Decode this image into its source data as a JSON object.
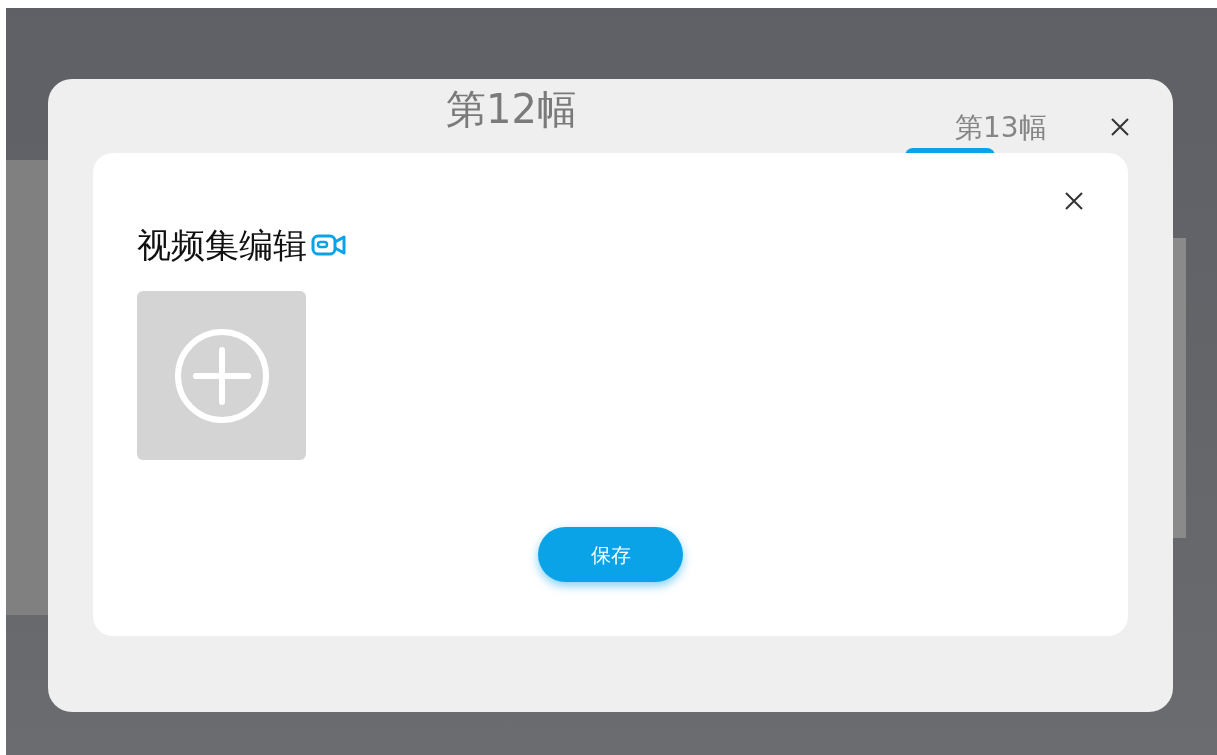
{
  "background": {
    "slides": [
      {
        "label": "第12幅"
      },
      {
        "label": "第13幅"
      }
    ]
  },
  "dialog": {
    "title": "视频集编辑",
    "upload_tile": {
      "kind": "add"
    },
    "buttons": [
      "保存"
    ]
  }
}
